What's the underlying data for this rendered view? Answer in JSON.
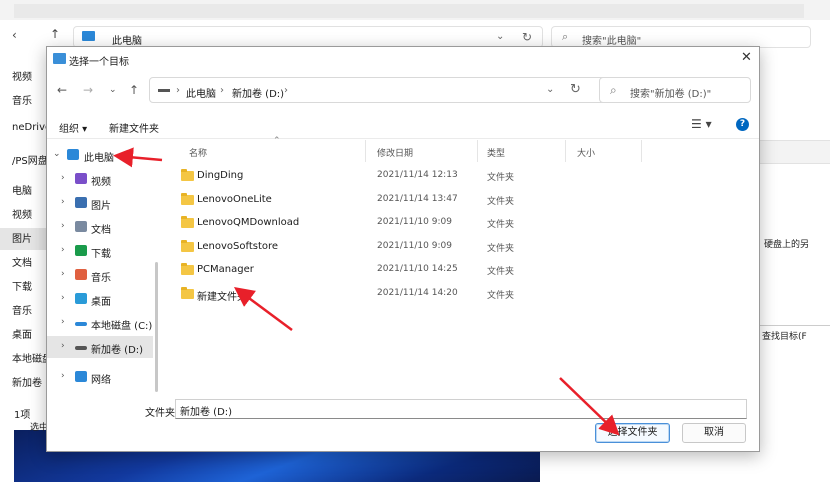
{
  "background": {
    "address": "此电脑",
    "search_placeholder": "搜索\"此电脑\"",
    "left_items": [
      "视频",
      "音乐",
      "neDrive",
      "/PS网盘",
      "电脑",
      "视频",
      "图片",
      "文档",
      "下载",
      "音乐",
      "桌面",
      "本地磁盘",
      "新加卷 (D"
    ],
    "bottom_text": "1项",
    "bottom_text2": "选中",
    "right_text1": "硬盘上的另",
    "right_text2": "查找目标(F"
  },
  "dialog": {
    "title": "选择一个目标",
    "breadcrumb": [
      "此电脑",
      "新加卷 (D:)"
    ],
    "search_placeholder": "搜索\"新加卷 (D:)\"",
    "organize": "组织 ▾",
    "new_folder": "新建文件夹",
    "nav_items": [
      {
        "label": "此电脑",
        "icon": "pc-icon",
        "color": "#2b88d8",
        "expanded": true
      },
      {
        "label": "视频",
        "icon": "video-icon",
        "color": "#7a4fc9"
      },
      {
        "label": "图片",
        "icon": "picture-icon",
        "color": "#3a6fb0"
      },
      {
        "label": "文档",
        "icon": "document-icon",
        "color": "#7a8aa0"
      },
      {
        "label": "下载",
        "icon": "download-icon",
        "color": "#1a9b4b"
      },
      {
        "label": "音乐",
        "icon": "music-icon",
        "color": "#e06040"
      },
      {
        "label": "桌面",
        "icon": "desktop-icon",
        "color": "#2a9bd8"
      },
      {
        "label": "本地磁盘 (C:)",
        "icon": "drive-c-icon",
        "color": "#2b88d8"
      },
      {
        "label": "新加卷 (D:)",
        "icon": "drive-d-icon",
        "color": "#555555",
        "selected": true
      },
      {
        "label": "网络",
        "icon": "network-icon",
        "color": "#2b88d8"
      }
    ],
    "columns": [
      "名称",
      "修改日期",
      "类型",
      "大小"
    ],
    "files": [
      {
        "name": "DingDing",
        "date": "2021/11/14 12:13",
        "type": "文件夹"
      },
      {
        "name": "LenovoOneLite",
        "date": "2021/11/14 13:47",
        "type": "文件夹"
      },
      {
        "name": "LenovoQMDownload",
        "date": "2021/11/10 9:09",
        "type": "文件夹"
      },
      {
        "name": "LenovoSoftstore",
        "date": "2021/11/10 9:09",
        "type": "文件夹"
      },
      {
        "name": "PCManager",
        "date": "2021/11/10 14:25",
        "type": "文件夹"
      },
      {
        "name": "新建文件夹",
        "date": "2021/11/14 14:20",
        "type": "文件夹"
      }
    ],
    "folder_label": "文件夹:",
    "folder_value": "新加卷 (D:)",
    "select_button": "选择文件夹",
    "cancel_button": "取消"
  },
  "colors": {
    "annotation_arrow": "#e8202a",
    "accent": "#0067c0"
  }
}
